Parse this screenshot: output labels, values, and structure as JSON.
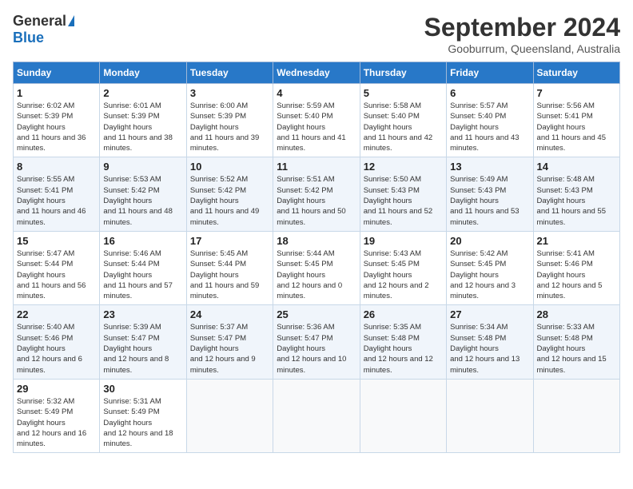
{
  "header": {
    "logo_general": "General",
    "logo_blue": "Blue",
    "title": "September 2024",
    "subtitle": "Gooburrum, Queensland, Australia"
  },
  "calendar": {
    "weekdays": [
      "Sunday",
      "Monday",
      "Tuesday",
      "Wednesday",
      "Thursday",
      "Friday",
      "Saturday"
    ],
    "weeks": [
      [
        {
          "day": "1",
          "sunrise": "6:02 AM",
          "sunset": "5:39 PM",
          "daylight": "11 hours and 36 minutes."
        },
        {
          "day": "2",
          "sunrise": "6:01 AM",
          "sunset": "5:39 PM",
          "daylight": "11 hours and 38 minutes."
        },
        {
          "day": "3",
          "sunrise": "6:00 AM",
          "sunset": "5:39 PM",
          "daylight": "11 hours and 39 minutes."
        },
        {
          "day": "4",
          "sunrise": "5:59 AM",
          "sunset": "5:40 PM",
          "daylight": "11 hours and 41 minutes."
        },
        {
          "day": "5",
          "sunrise": "5:58 AM",
          "sunset": "5:40 PM",
          "daylight": "11 hours and 42 minutes."
        },
        {
          "day": "6",
          "sunrise": "5:57 AM",
          "sunset": "5:40 PM",
          "daylight": "11 hours and 43 minutes."
        },
        {
          "day": "7",
          "sunrise": "5:56 AM",
          "sunset": "5:41 PM",
          "daylight": "11 hours and 45 minutes."
        }
      ],
      [
        {
          "day": "8",
          "sunrise": "5:55 AM",
          "sunset": "5:41 PM",
          "daylight": "11 hours and 46 minutes."
        },
        {
          "day": "9",
          "sunrise": "5:53 AM",
          "sunset": "5:42 PM",
          "daylight": "11 hours and 48 minutes."
        },
        {
          "day": "10",
          "sunrise": "5:52 AM",
          "sunset": "5:42 PM",
          "daylight": "11 hours and 49 minutes."
        },
        {
          "day": "11",
          "sunrise": "5:51 AM",
          "sunset": "5:42 PM",
          "daylight": "11 hours and 50 minutes."
        },
        {
          "day": "12",
          "sunrise": "5:50 AM",
          "sunset": "5:43 PM",
          "daylight": "11 hours and 52 minutes."
        },
        {
          "day": "13",
          "sunrise": "5:49 AM",
          "sunset": "5:43 PM",
          "daylight": "11 hours and 53 minutes."
        },
        {
          "day": "14",
          "sunrise": "5:48 AM",
          "sunset": "5:43 PM",
          "daylight": "11 hours and 55 minutes."
        }
      ],
      [
        {
          "day": "15",
          "sunrise": "5:47 AM",
          "sunset": "5:44 PM",
          "daylight": "11 hours and 56 minutes."
        },
        {
          "day": "16",
          "sunrise": "5:46 AM",
          "sunset": "5:44 PM",
          "daylight": "11 hours and 57 minutes."
        },
        {
          "day": "17",
          "sunrise": "5:45 AM",
          "sunset": "5:44 PM",
          "daylight": "11 hours and 59 minutes."
        },
        {
          "day": "18",
          "sunrise": "5:44 AM",
          "sunset": "5:45 PM",
          "daylight": "12 hours and 0 minutes."
        },
        {
          "day": "19",
          "sunrise": "5:43 AM",
          "sunset": "5:45 PM",
          "daylight": "12 hours and 2 minutes."
        },
        {
          "day": "20",
          "sunrise": "5:42 AM",
          "sunset": "5:45 PM",
          "daylight": "12 hours and 3 minutes."
        },
        {
          "day": "21",
          "sunrise": "5:41 AM",
          "sunset": "5:46 PM",
          "daylight": "12 hours and 5 minutes."
        }
      ],
      [
        {
          "day": "22",
          "sunrise": "5:40 AM",
          "sunset": "5:46 PM",
          "daylight": "12 hours and 6 minutes."
        },
        {
          "day": "23",
          "sunrise": "5:39 AM",
          "sunset": "5:47 PM",
          "daylight": "12 hours and 8 minutes."
        },
        {
          "day": "24",
          "sunrise": "5:37 AM",
          "sunset": "5:47 PM",
          "daylight": "12 hours and 9 minutes."
        },
        {
          "day": "25",
          "sunrise": "5:36 AM",
          "sunset": "5:47 PM",
          "daylight": "12 hours and 10 minutes."
        },
        {
          "day": "26",
          "sunrise": "5:35 AM",
          "sunset": "5:48 PM",
          "daylight": "12 hours and 12 minutes."
        },
        {
          "day": "27",
          "sunrise": "5:34 AM",
          "sunset": "5:48 PM",
          "daylight": "12 hours and 13 minutes."
        },
        {
          "day": "28",
          "sunrise": "5:33 AM",
          "sunset": "5:48 PM",
          "daylight": "12 hours and 15 minutes."
        }
      ],
      [
        {
          "day": "29",
          "sunrise": "5:32 AM",
          "sunset": "5:49 PM",
          "daylight": "12 hours and 16 minutes."
        },
        {
          "day": "30",
          "sunrise": "5:31 AM",
          "sunset": "5:49 PM",
          "daylight": "12 hours and 18 minutes."
        },
        null,
        null,
        null,
        null,
        null
      ]
    ]
  }
}
